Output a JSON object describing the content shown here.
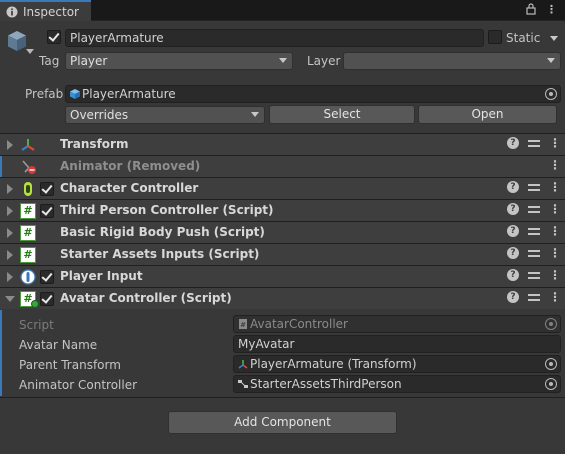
{
  "tab": {
    "title": "Inspector"
  },
  "gameobject": {
    "name": "PlayerArmature",
    "static_label": "Static",
    "tag_label": "Tag",
    "tag_value": "Player",
    "layer_label": "Layer",
    "layer_value": "",
    "prefab_label": "Prefab",
    "prefab_value": "PlayerArmature",
    "overrides_label": "Overrides",
    "select_label": "Select",
    "open_label": "Open"
  },
  "components": [
    {
      "name": "Transform",
      "icon": "transform-icon",
      "checkbox": false,
      "removed": false,
      "help": true
    },
    {
      "name": "Animator (Removed)",
      "icon": "animator-removed-icon",
      "checkbox": false,
      "removed": true,
      "help": false
    },
    {
      "name": "Character Controller",
      "icon": "character-controller-icon",
      "checkbox": true,
      "removed": false,
      "help": true
    },
    {
      "name": "Third Person Controller (Script)",
      "icon": "script-icon",
      "checkbox": true,
      "removed": false,
      "help": true
    },
    {
      "name": "Basic Rigid Body Push (Script)",
      "icon": "script-icon",
      "checkbox": false,
      "removed": false,
      "help": true
    },
    {
      "name": "Starter Assets Inputs (Script)",
      "icon": "script-icon",
      "checkbox": false,
      "removed": false,
      "help": true
    },
    {
      "name": "Player Input",
      "icon": "player-input-icon",
      "checkbox": true,
      "removed": false,
      "help": true
    },
    {
      "name": "Avatar Controller (Script)",
      "icon": "script-icon",
      "checkbox": true,
      "removed": false,
      "help": true
    }
  ],
  "avatar_controller": {
    "script_label": "Script",
    "script_value": "AvatarController",
    "avatar_name_label": "Avatar Name",
    "avatar_name_value": "MyAvatar",
    "parent_transform_label": "Parent Transform",
    "parent_transform_value": "PlayerArmature (Transform)",
    "animator_controller_label": "Animator Controller",
    "animator_controller_value": "StarterAssetsThirdPerson"
  },
  "add_component_label": "Add Component",
  "colors": {
    "accent": "#3a79bb",
    "panel": "#383838",
    "header": "#3e3e3e",
    "field": "#2a2a2a"
  }
}
